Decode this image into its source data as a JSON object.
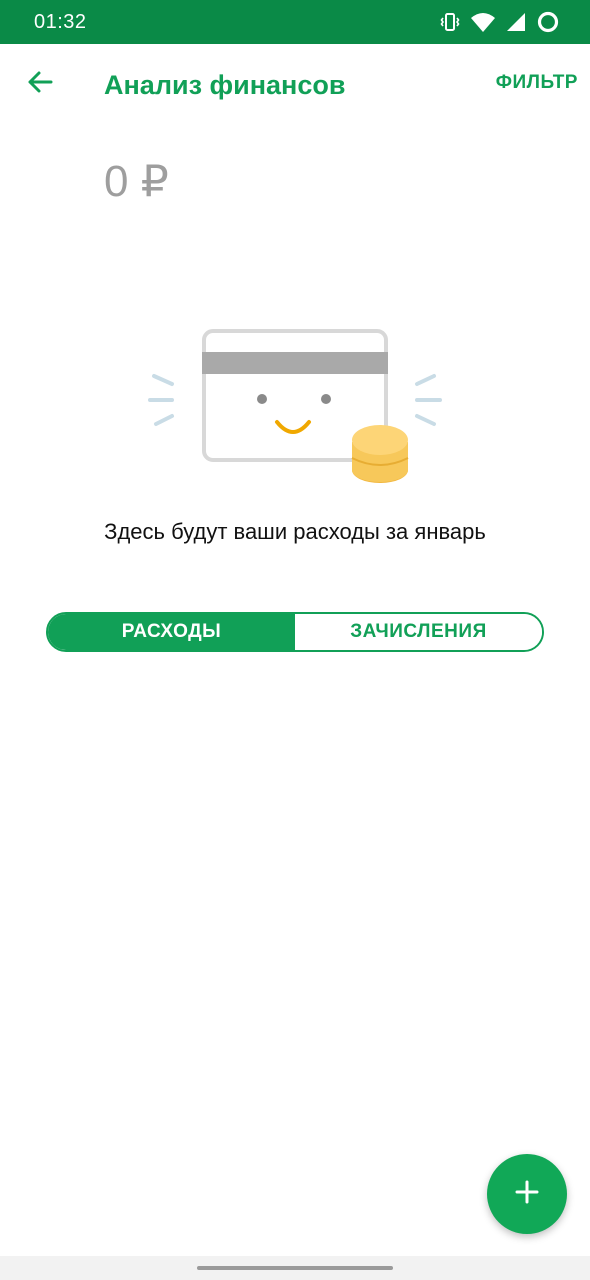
{
  "status_bar": {
    "time": "01:32",
    "icons": [
      "vibrate-icon",
      "wifi-icon",
      "signal-icon",
      "sync-circle-icon"
    ]
  },
  "header": {
    "title": "Анализ финансов",
    "filter_label": "ФИЛЬТР",
    "back_icon": "arrow-back-icon"
  },
  "summary": {
    "amount": "0 ₽"
  },
  "empty_state": {
    "illustration": "smiling-card-with-coins",
    "message": "Здесь будут ваши расходы за январь"
  },
  "tabs": [
    {
      "label": "РАСХОДЫ",
      "active": true
    },
    {
      "label": "ЗАЧИСЛЕНИЯ",
      "active": false
    }
  ],
  "fab": {
    "icon": "plus-icon"
  },
  "colors": {
    "primary": "#11a057",
    "status_bar": "#0a8a47",
    "amount_gray": "#9e9e9e",
    "coin": "#f7c85a"
  }
}
